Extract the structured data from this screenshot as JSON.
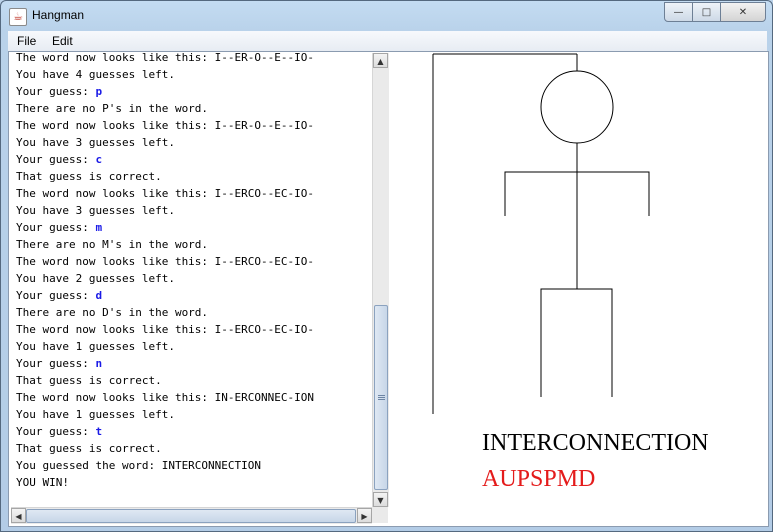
{
  "window": {
    "title": "Hangman",
    "controls": {
      "minimize": "—",
      "maximize": "□",
      "close": "✕"
    }
  },
  "menubar": {
    "items": [
      "File",
      "Edit"
    ]
  },
  "transcript": [
    {
      "text": "The word now looks like this: I--ER-O--E--IO-"
    },
    {
      "text": "You have 4 guesses left."
    },
    {
      "text": "Your guess: ",
      "guess": "p"
    },
    {
      "text": "There are no P's in the word."
    },
    {
      "text": "The word now looks like this: I--ER-O--E--IO-"
    },
    {
      "text": "You have 3 guesses left."
    },
    {
      "text": "Your guess: ",
      "guess": "c"
    },
    {
      "text": "That guess is correct."
    },
    {
      "text": "The word now looks like this: I--ERCO--EC-IO-"
    },
    {
      "text": "You have 3 guesses left."
    },
    {
      "text": "Your guess: ",
      "guess": "m"
    },
    {
      "text": "There are no M's in the word."
    },
    {
      "text": "The word now looks like this: I--ERCO--EC-IO-"
    },
    {
      "text": "You have 2 guesses left."
    },
    {
      "text": "Your guess: ",
      "guess": "d"
    },
    {
      "text": "There are no D's in the word."
    },
    {
      "text": "The word now looks like this: I--ERCO--EC-IO-"
    },
    {
      "text": "You have 1 guesses left."
    },
    {
      "text": "Your guess: ",
      "guess": "n"
    },
    {
      "text": "That guess is correct."
    },
    {
      "text": "The word now looks like this: IN-ERCONNEC-ION"
    },
    {
      "text": "You have 1 guesses left."
    },
    {
      "text": "Your guess: ",
      "guess": "t"
    },
    {
      "text": "That guess is correct."
    },
    {
      "text": "You guessed the word: INTERCONNECTION"
    },
    {
      "text": "YOU WIN!"
    }
  ],
  "scrollbars": {
    "up_arrow": "▲",
    "down_arrow": "▼",
    "left_arrow": "◀",
    "right_arrow": "▶",
    "vertical_position": 0.95
  },
  "hangman": {
    "word": "INTERCONNECTION",
    "wrong_guesses": "AUPSPMD",
    "colors": {
      "word": "#000000",
      "wrong_guesses": "#e41b1b",
      "guess_letter": "#1a1ae6"
    }
  }
}
